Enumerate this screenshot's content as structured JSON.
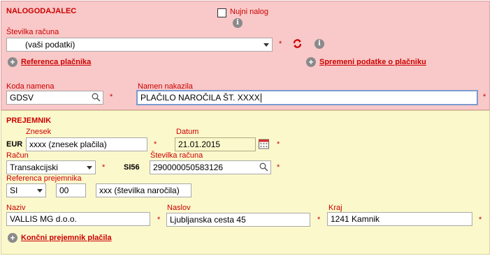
{
  "payer": {
    "section_title": "NALOGODAJALEC",
    "urgent_label": "Nujni nalog",
    "account_label": "Številka računa",
    "account_value": "(vaši podatki)",
    "reference_link": "Referenca plačnika",
    "change_link": "Spremeni podatke o plačniku",
    "purpose_code_label": "Koda namena",
    "purpose_code_value": "GDSV",
    "purpose_label": "Namen nakazila",
    "purpose_value": "PLAČILO NAROČILA ŠT. XXXX"
  },
  "recipient": {
    "section_title": "PREJEMNIK",
    "amount_label": "Znesek",
    "currency": "EUR",
    "amount_value": "xxxx (znesek plačila)",
    "date_label": "Datum",
    "date_value": "21.01.2015",
    "account_type_label": "Račun",
    "account_type_value": "Transakcijski",
    "iban_prefix": "SI56",
    "account_label": "Številka računa",
    "account_value": "290000050583126",
    "reference_label": "Referenca prejemnika",
    "ref_country": "SI",
    "ref_model": "00",
    "ref_number": "xxx (številka naročila)",
    "name_label": "Naziv",
    "name_value": "VALLIS MG d.o.o.",
    "address_label": "Naslov",
    "address_value": "Ljubljanska cesta 45",
    "city_label": "Kraj",
    "city_value": "1241 Kamnik",
    "final_recipient_link": "Končni prejemnik plačila"
  },
  "required_marker": "*"
}
